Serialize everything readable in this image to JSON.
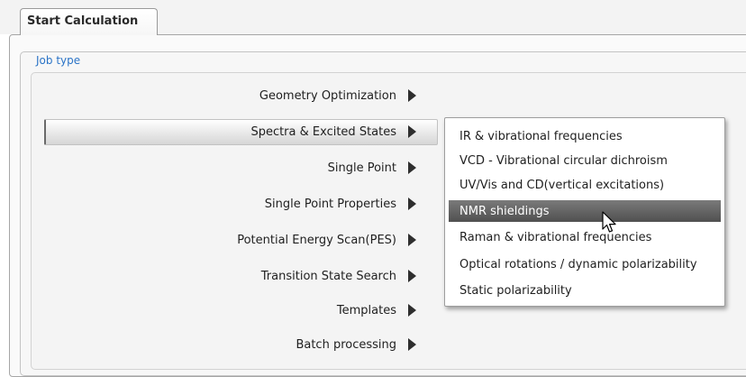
{
  "tab": {
    "label": "Start Calculation"
  },
  "group": {
    "title": "Job type"
  },
  "job_types": [
    {
      "label": "Geometry Optimization"
    },
    {
      "label": "Spectra & Excited States"
    },
    {
      "label": "Single Point"
    },
    {
      "label": "Single Point Properties"
    },
    {
      "label": "Potential Energy Scan(PES)"
    },
    {
      "label": "Transition State Search"
    },
    {
      "label": "Templates"
    },
    {
      "label": "Batch processing"
    }
  ],
  "submenu": {
    "items": [
      {
        "label": "IR & vibrational frequencies"
      },
      {
        "label": "VCD - Vibrational circular dichroism"
      },
      {
        "label": "UV/Vis and CD(vertical excitations)"
      },
      {
        "label": "NMR shieldings"
      },
      {
        "label": "Raman & vibrational frequencies"
      },
      {
        "label": "Optical rotations / dynamic polarizability"
      },
      {
        "label": "Static polarizability"
      }
    ],
    "highlighted_item": "NMR shieldings"
  },
  "icons": {
    "submenu_arrow": "triangle-right-icon",
    "pointer": "mouse-pointer-icon"
  },
  "colors": {
    "group_title": "#2b74c7",
    "highlight": "#5c5c5c"
  }
}
